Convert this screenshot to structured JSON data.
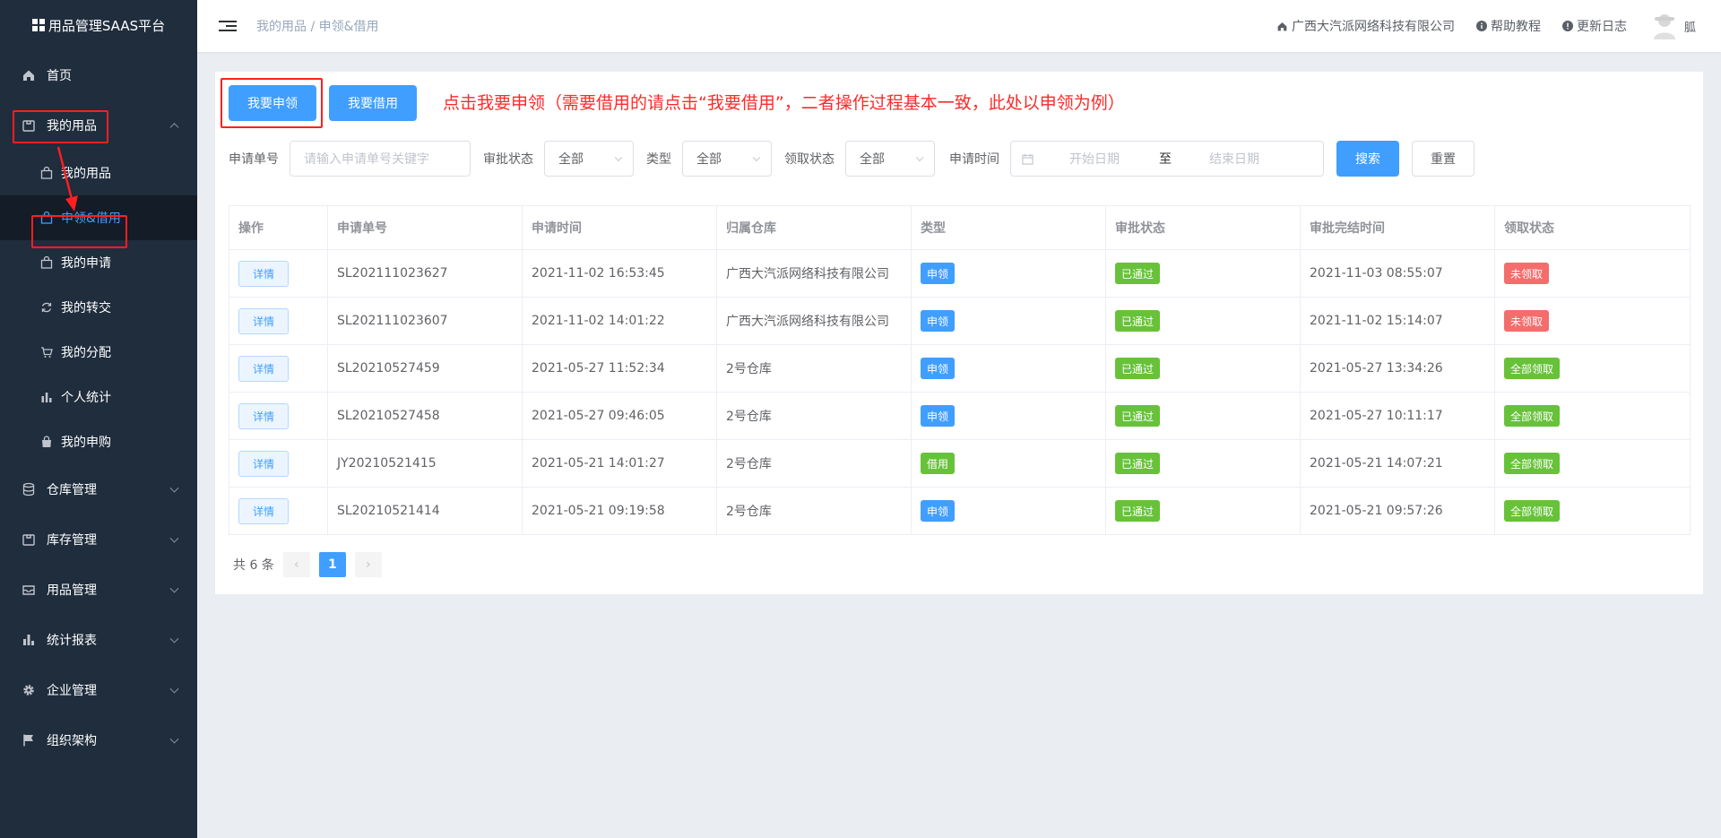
{
  "app": {
    "title": "用品管理SAAS平台"
  },
  "sidebar": {
    "home": "首页",
    "my_items": {
      "label": "我的用品",
      "children": [
        {
          "label": "我的用品",
          "icon": "bag-icon"
        },
        {
          "label": "申领&借用",
          "icon": "bag-icon"
        },
        {
          "label": "我的申请",
          "icon": "bag-icon"
        },
        {
          "label": "我的转交",
          "icon": "refresh-icon"
        },
        {
          "label": "我的分配",
          "icon": "cart-icon"
        },
        {
          "label": "个人统计",
          "icon": "bar-chart-icon"
        },
        {
          "label": "我的申购",
          "icon": "shopping-bag-icon"
        }
      ]
    },
    "groups": [
      {
        "label": "仓库管理",
        "icon": "database-icon"
      },
      {
        "label": "库存管理",
        "icon": "box-icon"
      },
      {
        "label": "用品管理",
        "icon": "tray-icon"
      },
      {
        "label": "统计报表",
        "icon": "bar-chart-icon"
      },
      {
        "label": "企业管理",
        "icon": "gear-icon"
      },
      {
        "label": "组织架构",
        "icon": "flag-icon"
      }
    ]
  },
  "header": {
    "breadcrumb_parent": "我的用品",
    "breadcrumb_sep": "/",
    "breadcrumb_current": "申领&借用",
    "company": "广西大汽派网络科技有限公司",
    "help": "帮助教程",
    "changelog": "更新日志",
    "user": "胍"
  },
  "toolbar": {
    "apply_button": "我要申领",
    "borrow_button": "我要借用",
    "tip": "点击我要申领（需要借用的请点击“我要借用”，二者操作过程基本一致，此处以申领为例）"
  },
  "filters": {
    "order_no_label": "申请单号",
    "order_no_placeholder": "请输入申请单号关键字",
    "approval_label": "审批状态",
    "approval_value": "全部",
    "type_label": "类型",
    "type_value": "全部",
    "receive_label": "领取状态",
    "receive_value": "全部",
    "time_label": "申请时间",
    "start_placeholder": "开始日期",
    "range_sep": "至",
    "end_placeholder": "结束日期",
    "search_button": "搜索",
    "reset_button": "重置"
  },
  "table": {
    "columns": [
      "操作",
      "申请单号",
      "申请时间",
      "归属仓库",
      "类型",
      "审批状态",
      "审批完结时间",
      "领取状态"
    ],
    "action_label": "详情",
    "rows": [
      {
        "no": "SL202111023627",
        "time": "2021-11-02 16:53:45",
        "warehouse": "广西大汽派网络科技有限公司",
        "type": "申领",
        "approval": "已通过",
        "done_time": "2021-11-03 08:55:07",
        "receive": "未领取"
      },
      {
        "no": "SL202111023607",
        "time": "2021-11-02 14:01:22",
        "warehouse": "广西大汽派网络科技有限公司",
        "type": "申领",
        "approval": "已通过",
        "done_time": "2021-11-02 15:14:07",
        "receive": "未领取"
      },
      {
        "no": "SL20210527459",
        "time": "2021-05-27 11:52:34",
        "warehouse": "2号仓库",
        "type": "申领",
        "approval": "已通过",
        "done_time": "2021-05-27 13:34:26",
        "receive": "全部领取"
      },
      {
        "no": "SL20210527458",
        "time": "2021-05-27 09:46:05",
        "warehouse": "2号仓库",
        "type": "申领",
        "approval": "已通过",
        "done_time": "2021-05-27 10:11:17",
        "receive": "全部领取"
      },
      {
        "no": "JY20210521415",
        "time": "2021-05-21 14:01:27",
        "warehouse": "2号仓库",
        "type": "借用",
        "approval": "已通过",
        "done_time": "2021-05-21 14:07:21",
        "receive": "全部领取"
      },
      {
        "no": "SL20210521414",
        "time": "2021-05-21 09:19:58",
        "warehouse": "2号仓库",
        "type": "申领",
        "approval": "已通过",
        "done_time": "2021-05-21 09:57:26",
        "receive": "全部领取"
      }
    ]
  },
  "pagination": {
    "total": "共 6 条",
    "current": "1",
    "prev": "‹",
    "next": "›"
  },
  "colors": {
    "sidebar_bg": "#1f2d3d",
    "primary": "#409eff",
    "success": "#67c23a",
    "danger": "#f56c6c",
    "annotation_red": "#ff1f1f"
  }
}
